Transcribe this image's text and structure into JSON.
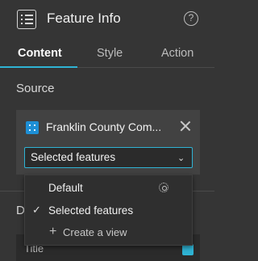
{
  "header": {
    "title": "Feature Info",
    "help_symbol": "?"
  },
  "tabs": [
    {
      "label": "Content",
      "active": true
    },
    {
      "label": "Style",
      "active": false
    },
    {
      "label": "Action",
      "active": false
    }
  ],
  "source": {
    "section_label": "Source",
    "datasource_name": "Franklin County Com...",
    "view_select": {
      "selected": "Selected features",
      "chevron": "⌄"
    }
  },
  "dropdown": {
    "options": [
      {
        "label": "Default",
        "selected": false,
        "has_settings_icon": true
      },
      {
        "label": "Selected features",
        "selected": true
      }
    ],
    "check_symbol": "✓",
    "create_view": {
      "plus": "+",
      "label": "Create a view"
    }
  },
  "behind": {
    "section_label_partial": "D",
    "row_label_partial": "Title"
  },
  "colors": {
    "accent": "#2fb3d4",
    "panel_bg": "#353535",
    "card_bg": "#424242",
    "menu_bg": "#2f2f2f",
    "datasource_icon": "#1e8fd5"
  }
}
